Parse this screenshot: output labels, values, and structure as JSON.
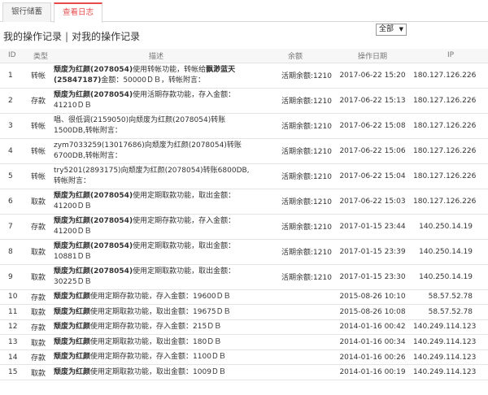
{
  "tabs": [
    {
      "label": "银行储蓄",
      "active": false
    },
    {
      "label": "查看日志",
      "active": true
    }
  ],
  "heading": {
    "mine": "我的操作记录",
    "separator": "|",
    "others": "对我的操作记录"
  },
  "filter": {
    "selected": "全部",
    "arrow": "▼"
  },
  "columns": {
    "id": "ID",
    "type": "类型",
    "desc": "描述",
    "balance": "余额",
    "date": "操作日期",
    "ip": "IP"
  },
  "rows": [
    {
      "id": "1",
      "type": "转帐",
      "desc_bold": "颓废为红颜(2078054)",
      "desc_rest": "使用转帐功能，转帐给",
      "desc_bold2": "飘渺蓝天(25847187)",
      "desc_rest2": "金额：50000ＤＢ，转帐附言：",
      "balance": "活期余额:1210",
      "date": "2017-06-22 15:20",
      "ip": "180.127.126.226"
    },
    {
      "id": "2",
      "type": "存款",
      "desc_bold": "颓废为红颜(2078054)",
      "desc_rest": "使用活期存款功能，存入金额：41210ＤＢ",
      "desc_bold2": "",
      "desc_rest2": "",
      "balance": "活期余额:1210",
      "date": "2017-06-22 15:13",
      "ip": "180.127.126.226"
    },
    {
      "id": "3",
      "type": "转帐",
      "desc_bold": "",
      "desc_rest": "唱、很低调(2159050)向颓废为红颜(2078054)转账1500DB,转帐附言：",
      "desc_bold2": "",
      "desc_rest2": "",
      "balance": "活期余额:1210",
      "date": "2017-06-22 15:08",
      "ip": "180.127.126.226"
    },
    {
      "id": "4",
      "type": "转帐",
      "desc_bold": "",
      "desc_rest": "zym7033259(13017686)向颓废为红颜(2078054)转账6700DB,转帐附言：",
      "desc_bold2": "",
      "desc_rest2": "",
      "balance": "活期余额:1210",
      "date": "2017-06-22 15:06",
      "ip": "180.127.126.226"
    },
    {
      "id": "5",
      "type": "转帐",
      "desc_bold": "",
      "desc_rest": "try5201(2893175)向颓废为红颜(2078054)转账6800DB,转帐附言：",
      "desc_bold2": "",
      "desc_rest2": "",
      "balance": "活期余额:1210",
      "date": "2017-06-22 15:04",
      "ip": "180.127.126.226"
    },
    {
      "id": "6",
      "type": "取款",
      "desc_bold": "颓废为红颜(2078054)",
      "desc_rest": "使用定期取款功能，取出金额：41200ＤＢ",
      "desc_bold2": "",
      "desc_rest2": "",
      "balance": "活期余额:1210",
      "date": "2017-06-22 15:03",
      "ip": "180.127.126.226"
    },
    {
      "id": "7",
      "type": "存款",
      "desc_bold": "颓废为红颜(2078054)",
      "desc_rest": "使用定期存款功能，存入金额：41200ＤＢ",
      "desc_bold2": "",
      "desc_rest2": "",
      "balance": "活期余额:1210",
      "date": "2017-01-15 23:44",
      "ip": "140.250.14.19"
    },
    {
      "id": "8",
      "type": "取款",
      "desc_bold": "颓废为红颜(2078054)",
      "desc_rest": "使用定期取款功能，取出金额：10881ＤＢ",
      "desc_bold2": "",
      "desc_rest2": "",
      "balance": "活期余额:1210",
      "date": "2017-01-15 23:39",
      "ip": "140.250.14.19"
    },
    {
      "id": "9",
      "type": "取款",
      "desc_bold": "颓废为红颜(2078054)",
      "desc_rest": "使用定期取款功能，取出金额：30225ＤＢ",
      "desc_bold2": "",
      "desc_rest2": "",
      "balance": "活期余额:1210",
      "date": "2017-01-15 23:30",
      "ip": "140.250.14.19"
    },
    {
      "id": "10",
      "type": "存款",
      "desc_bold": "颓废为红颜",
      "desc_rest": "使用定期存款功能，存入金额：19600ＤＢ",
      "desc_bold2": "",
      "desc_rest2": "",
      "balance": "",
      "date": "2015-08-26 10:10",
      "ip": "58.57.52.78"
    },
    {
      "id": "11",
      "type": "取款",
      "desc_bold": "颓废为红颜",
      "desc_rest": "使用定期取款功能，取出金额：19675ＤＢ",
      "desc_bold2": "",
      "desc_rest2": "",
      "balance": "",
      "date": "2015-08-26 10:08",
      "ip": "58.57.52.78"
    },
    {
      "id": "12",
      "type": "存款",
      "desc_bold": "颓废为红颜",
      "desc_rest": "使用定期存款功能，存入金额：215ＤＢ",
      "desc_bold2": "",
      "desc_rest2": "",
      "balance": "",
      "date": "2014-01-16 00:42",
      "ip": "140.249.114.123"
    },
    {
      "id": "13",
      "type": "取款",
      "desc_bold": "颓废为红颜",
      "desc_rest": "使用定期取款功能，取出金额：180ＤＢ",
      "desc_bold2": "",
      "desc_rest2": "",
      "balance": "",
      "date": "2014-01-16 00:34",
      "ip": "140.249.114.123"
    },
    {
      "id": "14",
      "type": "存款",
      "desc_bold": "颓废为红颜",
      "desc_rest": "使用定期存款功能，存入金额：1100ＤＢ",
      "desc_bold2": "",
      "desc_rest2": "",
      "balance": "",
      "date": "2014-01-16 00:26",
      "ip": "140.249.114.123"
    },
    {
      "id": "15",
      "type": "取款",
      "desc_bold": "颓废为红颜",
      "desc_rest": "使用定期取款功能，取出金额：1009ＤＢ",
      "desc_bold2": "",
      "desc_rest2": "",
      "balance": "",
      "date": "2014-01-16 00:19",
      "ip": "140.249.114.123"
    }
  ]
}
